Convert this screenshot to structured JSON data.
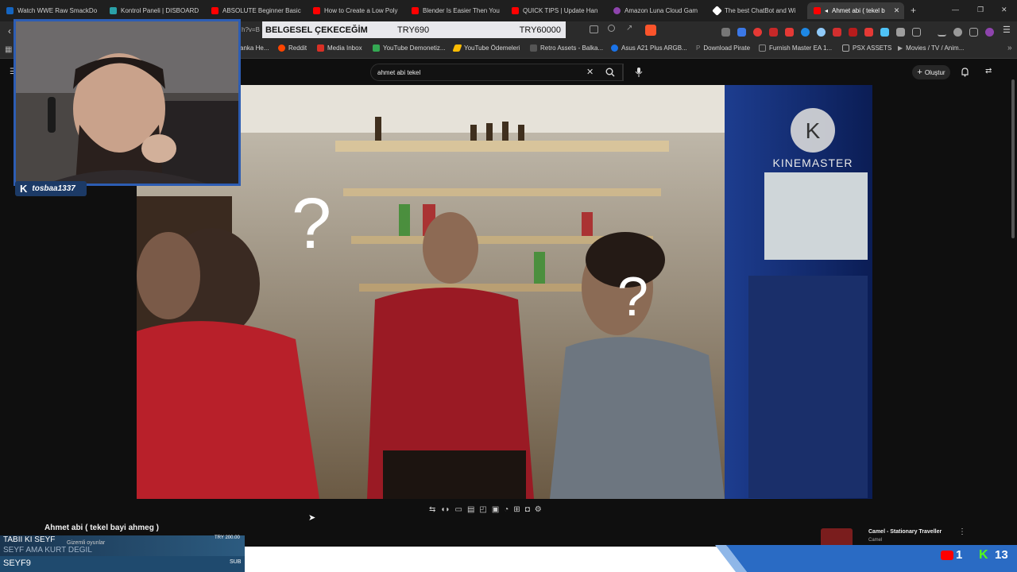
{
  "tabs": [
    {
      "title": "Watch WWE Raw SmackDo",
      "color": "#1565c0"
    },
    {
      "title": "Kontrol Paneli | DISBOARD",
      "color": "#2aa1a8"
    },
    {
      "title": "ABSOLUTE Beginner Basic",
      "color": "#ff0000"
    },
    {
      "title": "How to Create a Low Poly",
      "color": "#ff0000"
    },
    {
      "title": "Blender Is Easier Then You",
      "color": "#ff0000"
    },
    {
      "title": "QUICK TIPS | Update Han",
      "color": "#ff0000"
    },
    {
      "title": "Amazon Luna Cloud Gam",
      "color": "#8e44ad"
    },
    {
      "title": "The best ChatBot and Wi",
      "color": "#ffffff"
    },
    {
      "title": "Ahmet abi ( tekel b",
      "color": "#ff0000"
    }
  ],
  "window_controls": {
    "minimize": "—",
    "maximize": "❐",
    "close": "✕"
  },
  "url_fragment": "h?v=B",
  "donation": {
    "message": "BELGESEL ÇEKECEĞİM",
    "amount": "TRY690",
    "goal": "TRY60000"
  },
  "bookmarks": [
    {
      "label": "anka He..."
    },
    {
      "label": "Reddit",
      "color": "#ff4500"
    },
    {
      "label": "Media Inbox",
      "color": "#d93025"
    },
    {
      "label": "YouTube Demonetiz...",
      "color": "#34a853"
    },
    {
      "label": "YouTube Ödemeleri",
      "color": "#fbbc04"
    },
    {
      "label": "Retro Assets - Balka...",
      "color": "#555555"
    },
    {
      "label": "Asus A21 Plus ARGB...",
      "color": "#1a73e8"
    },
    {
      "label": "Download Pirate",
      "color": "#777777"
    },
    {
      "label": "Furnish Master EA 1...",
      "color": "#888888"
    },
    {
      "label": "PSX ASSETS",
      "color": "#aaaaaa"
    },
    {
      "label": "Movies / TV / Anim...",
      "color": "#aaaaaa"
    }
  ],
  "search": {
    "query": "ahmet abi tekel"
  },
  "header": {
    "create_label": "Oluştur"
  },
  "webcam": {
    "username": "tosbaa1337"
  },
  "video": {
    "watermark": "KINEMASTER",
    "overlay_marks": [
      "?",
      "?"
    ]
  },
  "video_title": "Ahmet abi ( tekel bayi ahmeg )",
  "sidebar_next": {
    "title": "Camel - Stationary Traveller",
    "channel": "Camel"
  },
  "stream_overlay": {
    "line1": "TABII KI SEYF",
    "line1b": "Gizemli oyunlar",
    "line2": "SEYF AMA KURT DEGIL",
    "line3": "SEYF9",
    "price": "TRY 200.00",
    "sub": "SUB",
    "youtube_count": "1",
    "kick_count": "13"
  },
  "colors": {
    "accent": "#2d5db3",
    "youtube": "#ff0000",
    "kick": "#53fc18"
  }
}
